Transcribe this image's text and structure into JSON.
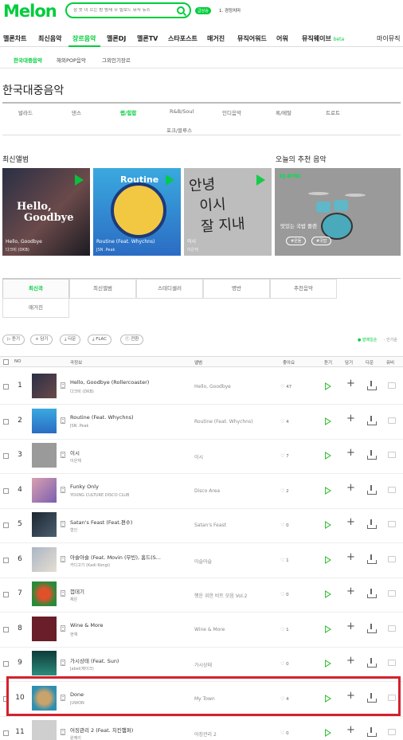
{
  "header": {
    "logo": "Melon",
    "search_placeholder": "잠 못 이 르는 밤 밤새 우 빌보드 뮤직 뉴스",
    "hot_badge": "급상승",
    "hot_keyword": "1. 경정치마"
  },
  "gnb": {
    "items": [
      {
        "label": "멜론차트"
      },
      {
        "label": "최신음악"
      },
      {
        "label": "장르음악"
      },
      {
        "label": "멜론DJ"
      },
      {
        "label": "멜론TV"
      },
      {
        "label": "스타포스트"
      },
      {
        "label": "매거진"
      },
      {
        "label": "뮤직어워드"
      },
      {
        "label": "어워"
      },
      {
        "label": "뮤직웨이브",
        "beta": "beta"
      },
      {
        "label": "마이뮤직"
      }
    ]
  },
  "subnav": {
    "items": [
      "한국대중음악",
      "해외POP음악",
      "그외인기장르"
    ]
  },
  "page_title": "한국대중음악",
  "genres": [
    "발라드",
    "댄스",
    "랩/힙합",
    "R&B/Soul",
    "인디음악",
    "록/메탈",
    "트로트",
    "포크/블루스"
  ],
  "new_albums": {
    "title": "최신앨범",
    "items": [
      {
        "title": "Hello, Goodbye",
        "artist": "다크비 (DKB)"
      },
      {
        "title": "Routine (Feat. Whychns)",
        "artist": "JSN .Peak"
      },
      {
        "title": "이시",
        "artist": "이은재"
      }
    ]
  },
  "dj": {
    "title": "오늘의 추천 음악",
    "label": "DJ AYNC",
    "playlist_title": "맛있는 국밥 플랜",
    "tags": [
      "#온들",
      "#국밥"
    ]
  },
  "tabs": [
    "최신곡",
    "최신앨범",
    "스테디셀러",
    "명반",
    "추천음악",
    "매거진"
  ],
  "actions": {
    "buttons": [
      "듣기",
      "담기",
      "다운",
      "FLAC",
      "전환"
    ],
    "sort_popular": "● 발매일순",
    "sort_name": "· 인기순"
  },
  "table": {
    "headers": [
      "NO",
      "곡정보",
      "앨범",
      "좋아요",
      "듣기",
      "담기",
      "다운",
      "뮤비"
    ],
    "rows": [
      {
        "no": "1",
        "title": "Hello, Goodbye (Rollercoaster)",
        "artist": "다크비 (DKB)",
        "album": "Hello, Goodbye",
        "likes": "47"
      },
      {
        "no": "2",
        "title": "Routine (Feat. Whychns)",
        "artist": "JSN .Peak",
        "album": "Routine (Feat. Whychns)",
        "likes": "4"
      },
      {
        "no": "3",
        "title": "이시",
        "artist": "이은재",
        "album": "이시",
        "likes": "7"
      },
      {
        "no": "4",
        "title": "Funky Only",
        "artist": "YOUNG CULTURE DISCO CLUB",
        "album": "Disco Area",
        "likes": "2"
      },
      {
        "no": "5",
        "title": "Satan's Feast (Feat.편수)",
        "artist": "형인",
        "album": "Satan's Feast",
        "likes": "0"
      },
      {
        "no": "6",
        "title": "아슬아슬 (Feat. Movin (무빈), 홈드(S...",
        "artist": "카디고기 (Kadi Kongi)",
        "album": "아슬아슬",
        "likes": "1"
      },
      {
        "no": "7",
        "title": "껍데기",
        "artist": "채은",
        "album": "행운 위한 비트 모음 Vol.2",
        "likes": "0"
      },
      {
        "no": "8",
        "title": "Wine & More",
        "artist": "현재",
        "album": "Wine & More",
        "likes": "1"
      },
      {
        "no": "9",
        "title": "가시상태 (Feat. Sun)",
        "artist": "Jabel(제이크)",
        "album": "가시상태",
        "likes": "0"
      },
      {
        "no": "10",
        "title": "Done",
        "artist": "JUWON",
        "album": "My Town",
        "likes": "4"
      },
      {
        "no": "11",
        "title": "어징관리 2 (Feat. 치킨햄퍼)",
        "artist": "원예이",
        "album": "어징관리 2",
        "likes": "0"
      }
    ]
  }
}
